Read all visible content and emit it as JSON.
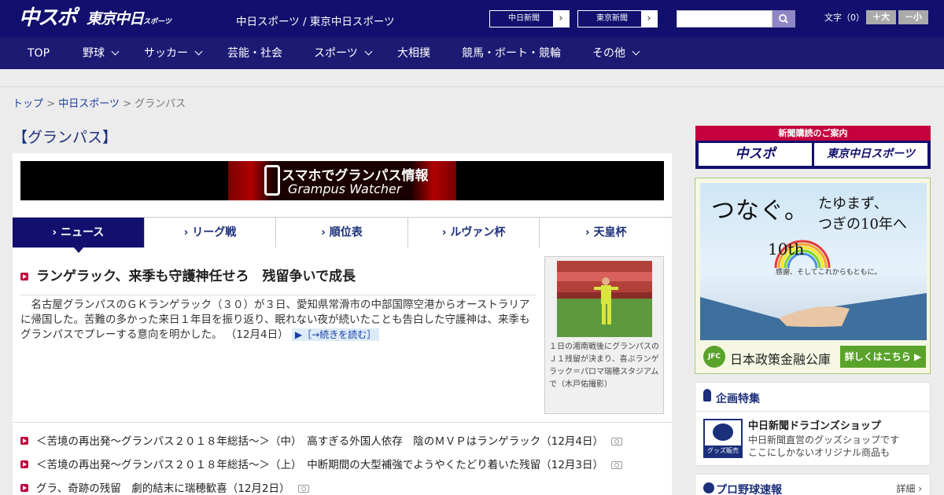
{
  "header": {
    "logo_chunichi_sports": "中スポ",
    "logo_tokyo_chunichi": "東京中日",
    "logo_tokyo_suffix": "スポーツ",
    "site_title": "中日スポーツ / 東京中日スポーツ",
    "link_chunichi_shimbun": "中日新聞",
    "link_tokyo_shimbun": "東京新聞",
    "arrow": "›",
    "search_placeholder": "",
    "font_size_label": "文字（0）",
    "font_larger": "＋大",
    "font_smaller": "－小"
  },
  "nav": {
    "items": [
      {
        "label": "TOP"
      },
      {
        "label": "野球"
      },
      {
        "label": "サッカー"
      },
      {
        "label": "芸能・社会"
      },
      {
        "label": "スポーツ"
      },
      {
        "label": "大相撲"
      },
      {
        "label": "競馬・ボート・競輪"
      },
      {
        "label": "その他"
      }
    ]
  },
  "breadcrumb": {
    "top": "トップ",
    "sep1": " > ",
    "chunichi_sports": "中日スポーツ",
    "sep2": " > ",
    "current": "グランパス"
  },
  "page_title": "【グランパス】",
  "banner": {
    "line1": "スマホでグランパス情報",
    "line2": "Grampus Watcher"
  },
  "tabs": [
    {
      "label": "› ニュース"
    },
    {
      "label": "› リーグ戦"
    },
    {
      "label": "› 順位表"
    },
    {
      "label": "› ルヴァン杯"
    },
    {
      "label": "› 天皇杯"
    }
  ],
  "top_story": {
    "headline": "ランゲラック、来季も守護神任せろ　残留争いで成長",
    "lead": "　名古屋グランパスのＧＫランゲラック（３０）が３日、愛知県常滑市の中部国際空港からオーストラリアに帰国した。苦難の多かった来日１年目を振り返り、眠れない夜が続いたことも告白した守護神は、来季もグランパスでプレーする意向を明かした。",
    "date": "（12月4日）",
    "more": "▶［→続きを読む］",
    "photo_caption": "１日の湘南戦後にグランパスのＪ１残留が決まり、喜ぶランゲラック＝パロマ瑞穂スタジアムで（木戸佑撮影）"
  },
  "news_list": [
    {
      "title": "＜苦境の再出発～グランパス２０１８年総括～＞（中）　高すぎる外国人依存　陰のＭＶＰはランゲラック（12月4日）"
    },
    {
      "title": "＜苦境の再出発～グランパス２０１８年総括～＞（上）　中断期間の大型補強でようやくたどり着いた残留（12月3日）"
    },
    {
      "title": "グラ、奇跡の残留　劇的結末に瑞穂歓喜（12月2日）"
    }
  ],
  "sidebar": {
    "subscribe_title": "新聞購読のご案内",
    "subscribe_chunichi": "中スポ",
    "subscribe_tokyo": "東京中日スポーツ",
    "ad": {
      "headline": "つなぐ。",
      "sub1": "たゆまず、",
      "sub2": "つぎの10年へ",
      "tenth": "10th",
      "tagline": "感謝、そしてこれからもともに。",
      "logo": "JFC",
      "org_name": "日本政策金融公庫",
      "cta": "詳しくはこちら ▶"
    },
    "feature": {
      "title": "企画特集",
      "shop_badge": "グッズ販売中",
      "shop_title": "中日新聞ドラゴンズショップ",
      "shop_desc1": "中日新聞直営のグッズショップです",
      "shop_desc2": "ここにしかないオリジナル商品も"
    },
    "baseball": {
      "title": "プロ野球速報",
      "detail": "詳細 ›"
    }
  },
  "colors": {
    "header_bg": "#120f6e",
    "nav_bg": "#1d1a74",
    "accent_red": "#c0003a",
    "link_blue": "#1a3ea3",
    "ad_green": "#5aa32b"
  }
}
